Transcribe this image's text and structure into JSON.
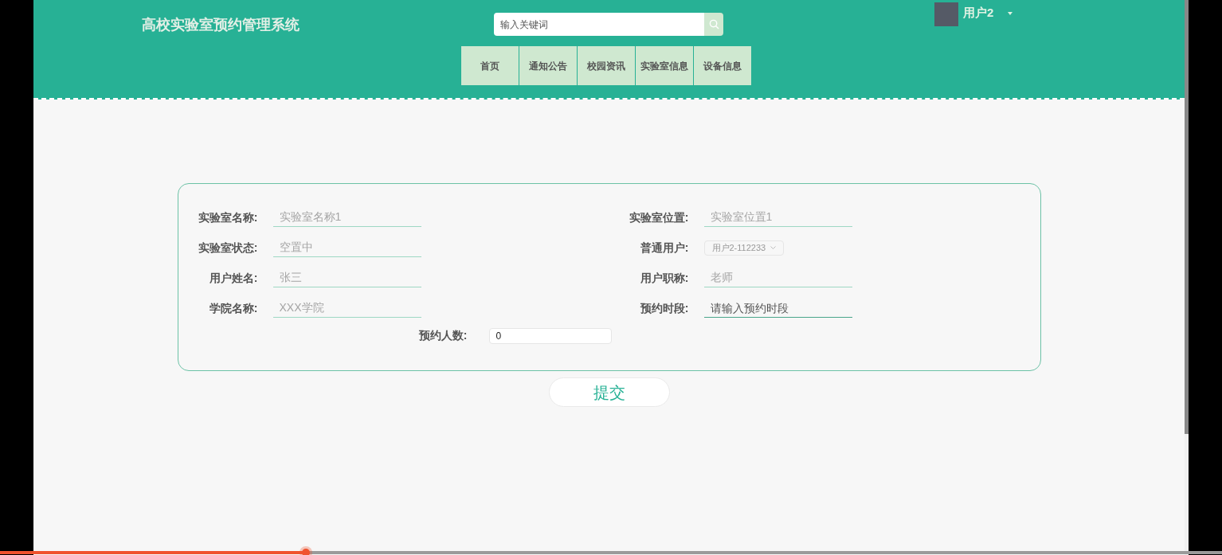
{
  "header": {
    "title": "高校实验室预约管理系统",
    "search": {
      "placeholder": "输入关键词"
    },
    "nav": [
      {
        "label": "首页",
        "selected": false
      },
      {
        "label": "通知公告",
        "selected": false
      },
      {
        "label": "校园资讯",
        "selected": false
      },
      {
        "label": "实验室信息",
        "selected": false
      },
      {
        "label": "设备信息",
        "selected": false
      }
    ],
    "user": {
      "name": "用户2"
    }
  },
  "form": {
    "fields": [
      {
        "kind": "text",
        "label": "实验室名称:",
        "value": "实验室名称1",
        "disabled": true
      },
      {
        "kind": "text",
        "label": "实验室位置:",
        "value": "实验室位置1",
        "disabled": true
      },
      {
        "kind": "text",
        "label": "实验室状态:",
        "value": "空置中",
        "disabled": true
      },
      {
        "kind": "select",
        "label": "普通用户:",
        "value": "用户2-112233",
        "disabled": true
      },
      {
        "kind": "text",
        "label": "用户姓名:",
        "value": "张三",
        "disabled": true
      },
      {
        "kind": "text",
        "label": "用户职称:",
        "value": "老师",
        "disabled": true
      },
      {
        "kind": "text",
        "label": "学院名称:",
        "value": "XXX学院",
        "disabled": true
      },
      {
        "kind": "text",
        "label": "预约时段:",
        "placeholder": "请输入预约时段",
        "disabled": false
      }
    ],
    "count": {
      "label": "预约人数:",
      "value": "0"
    },
    "submit": "提交"
  },
  "video": {
    "level": 0.25
  }
}
